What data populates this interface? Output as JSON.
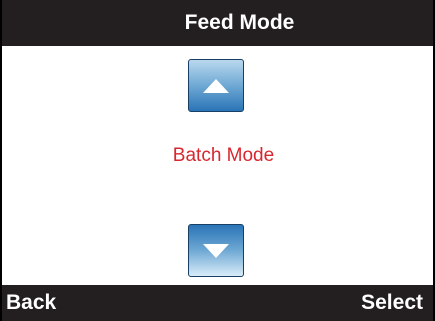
{
  "header": {
    "title": "Feed Mode"
  },
  "main": {
    "mode_label": "Batch Mode",
    "up_icon": "arrow-up-icon",
    "down_icon": "arrow-down-icon"
  },
  "footer": {
    "back_label": "Back",
    "select_label": "Select"
  },
  "colors": {
    "bar_background": "#231f20",
    "mode_text": "#d8272f",
    "button_blue": "#2a74b6"
  }
}
